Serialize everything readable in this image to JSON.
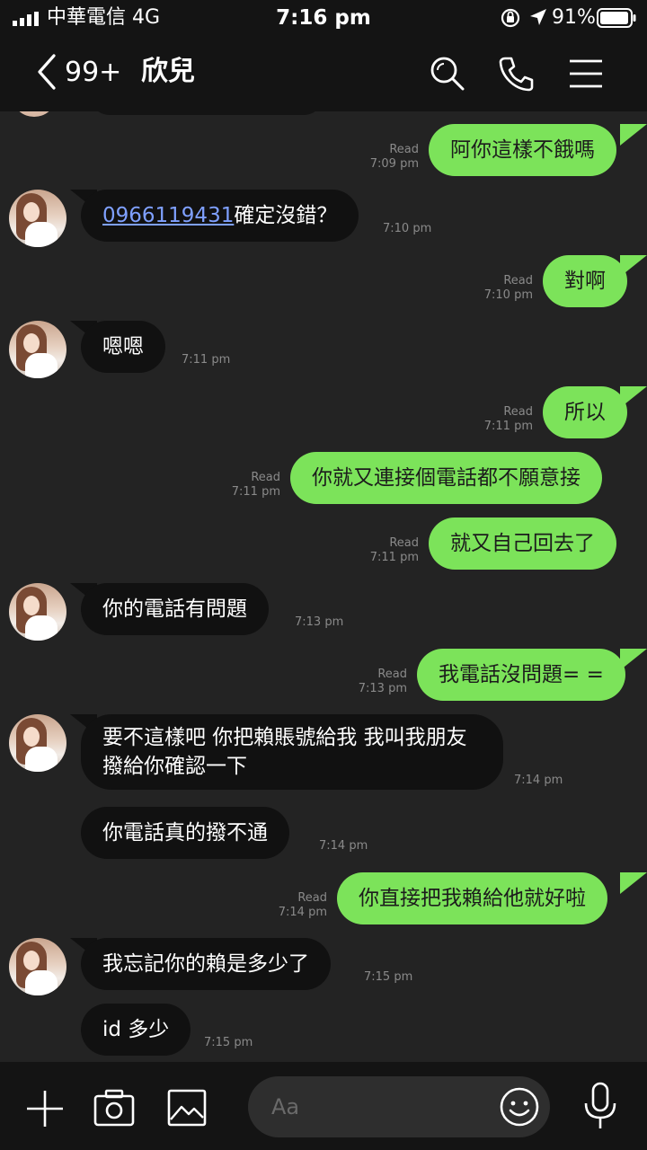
{
  "status_bar": {
    "carrier": "中華電信  4G",
    "time": "7:16 pm",
    "battery": "91%"
  },
  "header": {
    "back_count": "99+",
    "title": "欣兒"
  },
  "messages": [
    {
      "side": "out",
      "text": "阿你這樣不餓嗎",
      "read": "Read",
      "time": "7:09 pm"
    },
    {
      "side": "in",
      "link": "0966119431",
      "text": "確定沒錯？",
      "time": "7:10 pm"
    },
    {
      "side": "out",
      "text": "對啊",
      "read": "Read",
      "time": "7:10 pm"
    },
    {
      "side": "in",
      "text": "嗯嗯",
      "time": "7:11 pm"
    },
    {
      "side": "out",
      "text": "所以",
      "read": "Read",
      "time": "7:11 pm"
    },
    {
      "side": "out",
      "text": "你就又連接個電話都不願意接",
      "read": "Read",
      "time": "7:11 pm"
    },
    {
      "side": "out",
      "text": "就又自己回去了",
      "read": "Read",
      "time": "7:11 pm"
    },
    {
      "side": "in",
      "text": "你的電話有問題",
      "time": "7:13 pm"
    },
    {
      "side": "out",
      "text": "我電話沒問題= =",
      "read": "Read",
      "time": "7:13 pm"
    },
    {
      "side": "in",
      "text": "要不這樣吧 你把賴賬號給我 我叫我朋友撥給你確認一下",
      "time": "7:14 pm"
    },
    {
      "side": "in",
      "text": "你電話真的撥不通",
      "time": "7:14 pm"
    },
    {
      "side": "out",
      "text": "你直接把我賴給他就好啦",
      "read": "Read",
      "time": "7:14 pm"
    },
    {
      "side": "in",
      "text": "我忘記你的賴是多少了",
      "time": "7:15 pm"
    },
    {
      "side": "in",
      "text": "id 多少",
      "time": "7:15 pm"
    }
  ],
  "input_bar": {
    "placeholder": "Aa"
  },
  "icons": {
    "back": "chevron-left-icon",
    "search": "search-icon",
    "call": "phone-icon",
    "menu": "hamburger-menu-icon",
    "plus": "plus-icon",
    "camera": "camera-icon",
    "image": "image-icon",
    "emoji": "emoji-icon",
    "mic": "microphone-icon"
  },
  "colors": {
    "outgoing_bubble": "#7ce35a",
    "incoming_bubble": "#111111",
    "background": "#232323",
    "link": "#7fa0ff"
  }
}
